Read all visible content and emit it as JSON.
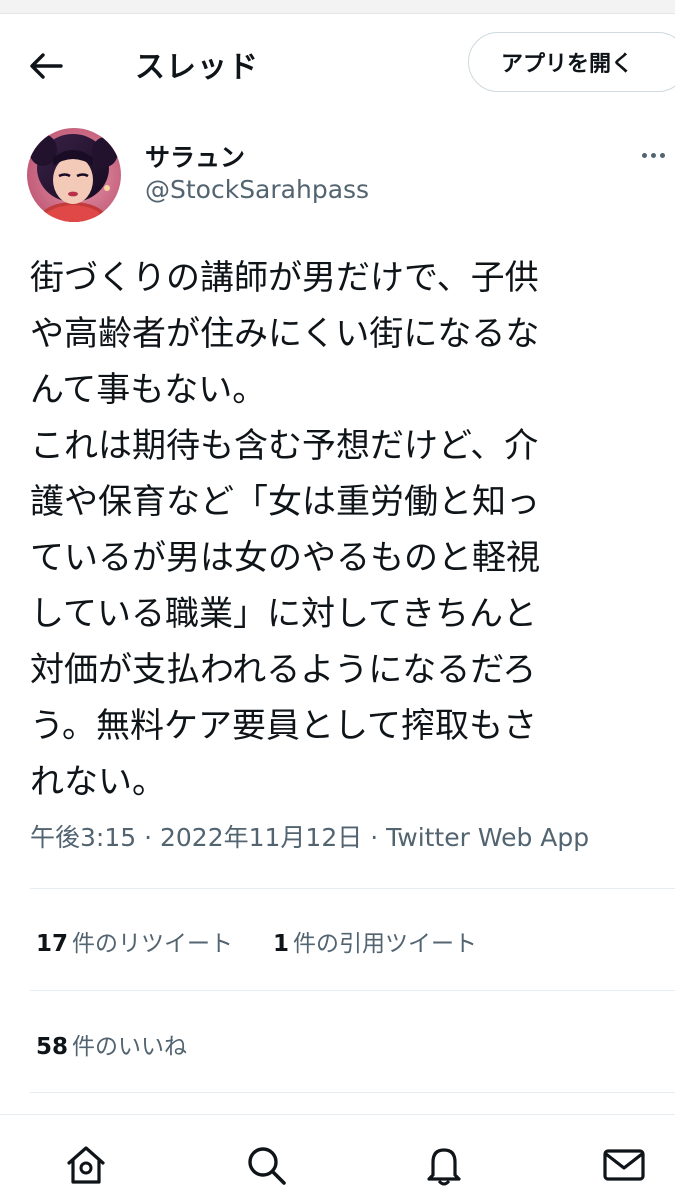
{
  "header": {
    "title": "スレッド",
    "open_app_label": "アプリを開く"
  },
  "user": {
    "display_name": "サラュン",
    "handle": "@StockSarahpass"
  },
  "tweet": {
    "lines": [
      "街づくりの講師が男だけで、子供",
      "や高齢者が住みにくい街になるな",
      "んて事もない。",
      "これは期待も含む予想だけど、介",
      "護や保育など「女は重労働と知っ",
      "ているが男は女のやるものと軽視",
      "している職業」に対してきちんと",
      "対価が支払われるようになるだろ",
      "う。無料ケア要員として搾取もさ",
      "れない。"
    ],
    "time": "午後3:15",
    "separator": "·",
    "date": "2022年11月12日",
    "source": "Twitter Web App"
  },
  "stats": {
    "retweets_count": "17",
    "retweets_label": "件のリツイート",
    "quotes_count": "1",
    "quotes_label": "件の引用ツイート",
    "likes_count": "58",
    "likes_label": "件のいいね"
  },
  "nav": {
    "items": [
      "home-icon",
      "search-icon",
      "bell-icon",
      "mail-icon"
    ]
  },
  "colors": {
    "text": "#0f1419",
    "secondary": "#536471",
    "border": "#cfd9de",
    "divider": "#e6ecf0"
  }
}
